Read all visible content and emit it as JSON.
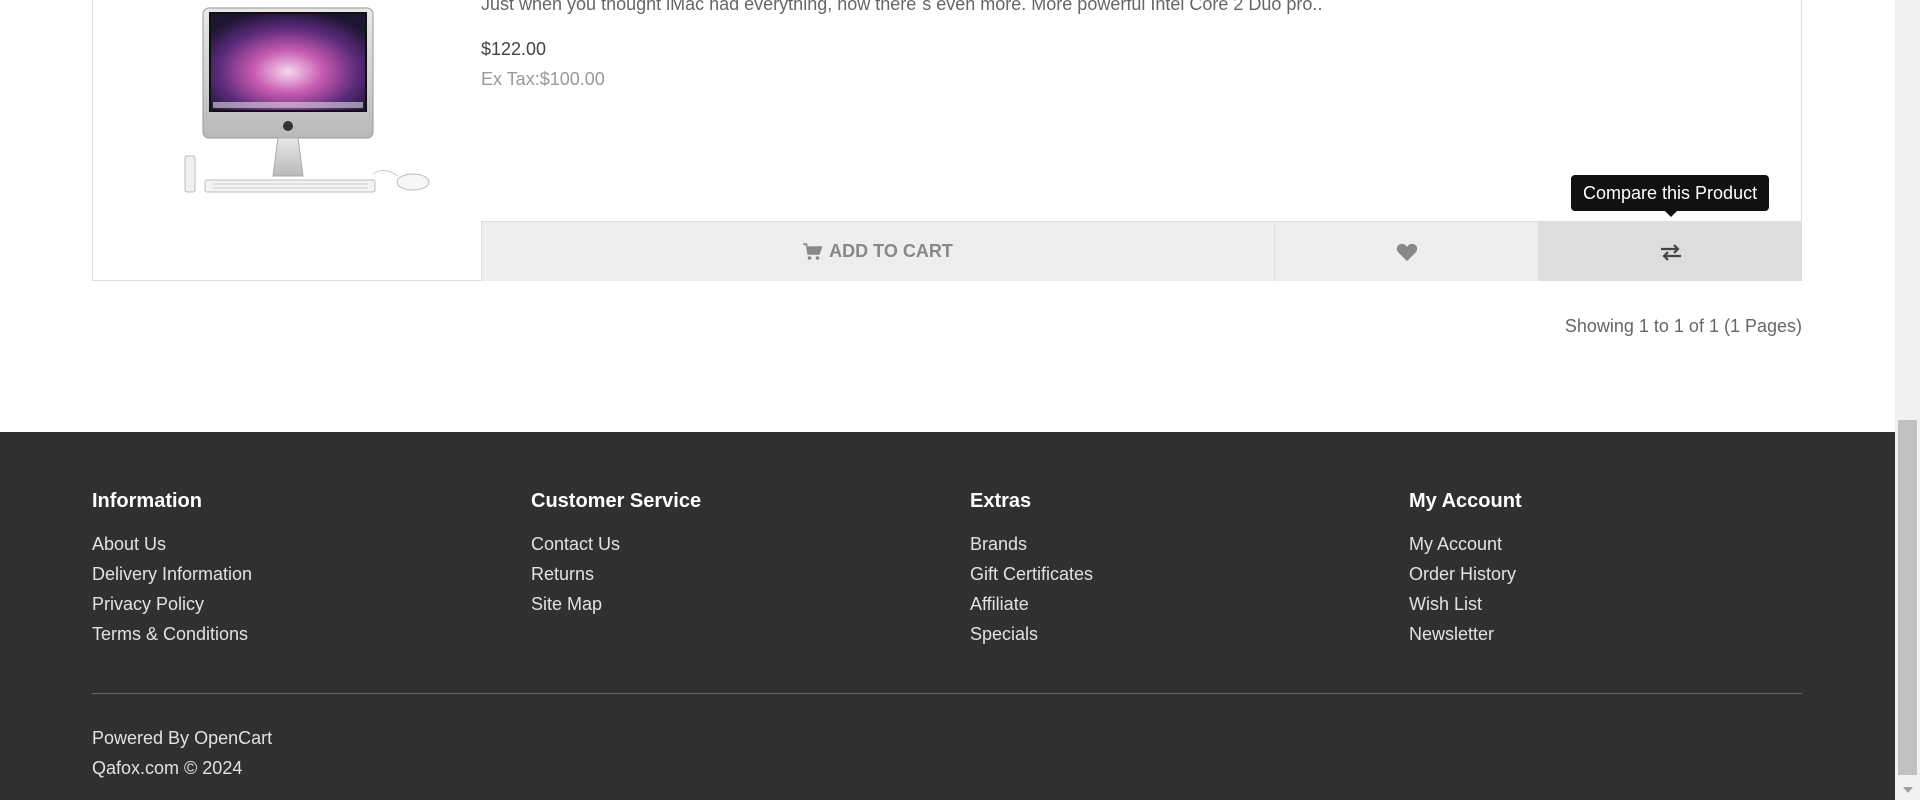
{
  "product": {
    "description": "Just when you thought iMac had everything, now there´s even more. More powerful Intel Core 2 Duo pro..",
    "price": "$122.00",
    "ex_tax": "Ex Tax:$100.00",
    "add_to_cart_label": "ADD TO CART",
    "compare_tooltip": "Compare this Product"
  },
  "pagination": {
    "results_text": "Showing 1 to 1 of 1 (1 Pages)"
  },
  "footer": {
    "columns": [
      {
        "title": "Information",
        "links": [
          "About Us",
          "Delivery Information",
          "Privacy Policy",
          "Terms & Conditions"
        ]
      },
      {
        "title": "Customer Service",
        "links": [
          "Contact Us",
          "Returns",
          "Site Map"
        ]
      },
      {
        "title": "Extras",
        "links": [
          "Brands",
          "Gift Certificates",
          "Affiliate",
          "Specials"
        ]
      },
      {
        "title": "My Account",
        "links": [
          "My Account",
          "Order History",
          "Wish List",
          "Newsletter"
        ]
      }
    ],
    "powered_by_prefix": "Powered By",
    "powered_by_link": "OpenCart",
    "copyright": "Qafox.com © 2024"
  },
  "icons": {
    "cart": "shopping-cart-icon",
    "wishlist": "heart-icon",
    "compare": "exchange-icon"
  },
  "colors": {
    "footer_bg": "#303030",
    "button_bg": "#eeeeee",
    "button_active_bg": "#dddddd",
    "tooltip_bg": "#111111"
  }
}
